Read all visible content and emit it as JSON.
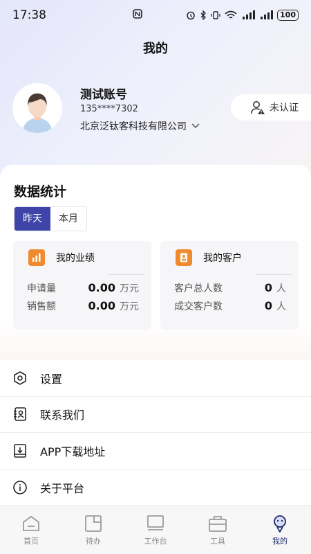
{
  "status_bar": {
    "time": "17:38",
    "battery": "100"
  },
  "page": {
    "title": "我的"
  },
  "profile": {
    "name": "测试账号",
    "phone": "135****7302",
    "company": "北京泛钛客科技有限公司",
    "verify_label": "未认证"
  },
  "stats": {
    "title": "数据统计",
    "tabs": [
      "昨天",
      "本月"
    ],
    "active_tab": "昨天",
    "performance": {
      "title": "我的业绩",
      "rows": [
        {
          "label": "申请量",
          "value": "0.00",
          "unit": "万元"
        },
        {
          "label": "销售额",
          "value": "0.00",
          "unit": "万元"
        }
      ]
    },
    "customers": {
      "title": "我的客户",
      "rows": [
        {
          "label": "客户总人数",
          "value": "0",
          "unit": "人"
        },
        {
          "label": "成交客户数",
          "value": "0",
          "unit": "人"
        }
      ]
    }
  },
  "menu": [
    {
      "label": "设置",
      "icon": "settings-hex-icon"
    },
    {
      "label": "联系我们",
      "icon": "contact-book-icon"
    },
    {
      "label": "APP下载地址",
      "icon": "download-icon"
    },
    {
      "label": "关于平台",
      "icon": "info-icon"
    }
  ],
  "tabbar": [
    {
      "label": "首页",
      "icon": "home-icon"
    },
    {
      "label": "待办",
      "icon": "todo-icon"
    },
    {
      "label": "工作台",
      "icon": "workbench-icon"
    },
    {
      "label": "工具",
      "icon": "toolbox-icon"
    },
    {
      "label": "我的",
      "icon": "me-icon"
    }
  ],
  "colors": {
    "accent": "#3e44a8",
    "orange": "#f08a2e",
    "tab_active": "#1c2a6b"
  }
}
